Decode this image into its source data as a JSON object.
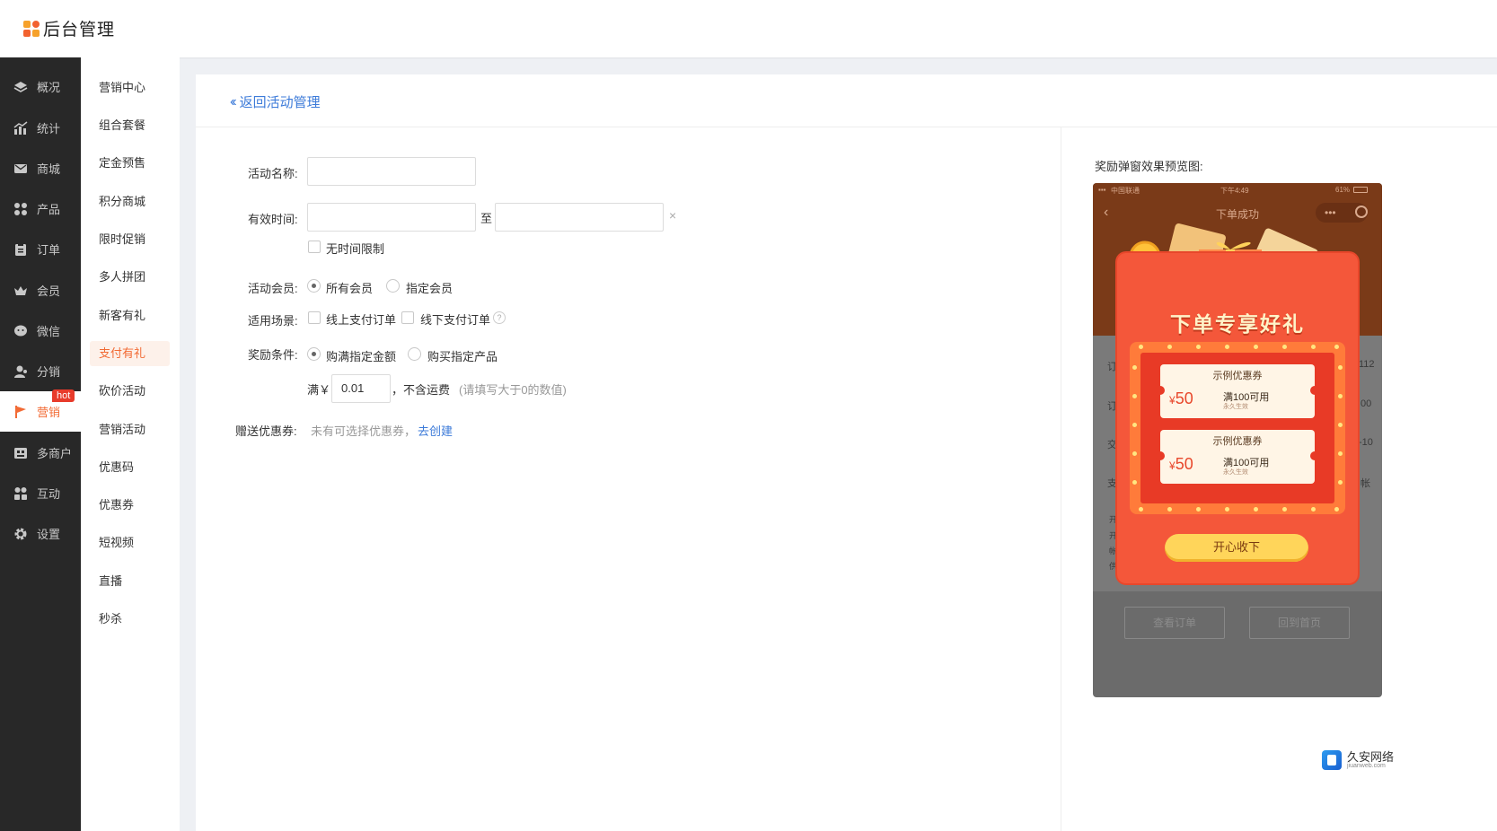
{
  "header": {
    "app_title": "后台管理"
  },
  "primary_nav": {
    "items": [
      {
        "label": "概况",
        "icon": "layers-icon"
      },
      {
        "label": "统计",
        "icon": "chart-icon"
      },
      {
        "label": "商城",
        "icon": "mail-icon"
      },
      {
        "label": "产品",
        "icon": "grid-icon"
      },
      {
        "label": "订单",
        "icon": "clipboard-icon"
      },
      {
        "label": "会员",
        "icon": "crown-icon"
      },
      {
        "label": "微信",
        "icon": "chat-icon"
      },
      {
        "label": "分销",
        "icon": "user-icon"
      },
      {
        "label": "营销",
        "icon": "flag-icon"
      },
      {
        "label": "多商户",
        "icon": "shop-icon"
      },
      {
        "label": "互动",
        "icon": "people-icon"
      },
      {
        "label": "设置",
        "icon": "gear-icon"
      }
    ],
    "hot_badge": "hot"
  },
  "secondary_nav": {
    "items": [
      "营销中心",
      "组合套餐",
      "定金预售",
      "积分商城",
      "限时促销",
      "多人拼团",
      "新客有礼",
      "支付有礼",
      "砍价活动",
      "营销活动",
      "优惠码",
      "优惠券",
      "短视频",
      "直播",
      "秒杀"
    ],
    "active": "支付有礼"
  },
  "page": {
    "back_link": "返回活动管理"
  },
  "form": {
    "name_label": "活动名称:",
    "name_value": "",
    "time_label": "有效时间:",
    "time_start": "",
    "time_sep": "至",
    "time_end": "",
    "time_clear": "×",
    "no_limit_label": "无时间限制",
    "member_label": "活动会员:",
    "member_all": "所有会员",
    "member_specific": "指定会员",
    "scene_label": "适用场景:",
    "scene_online": "线上支付订单",
    "scene_offline": "线下支付订单",
    "help": "?",
    "reward_label": "奖励条件:",
    "reward_amount": "购满指定金额",
    "reward_product": "购买指定产品",
    "full_prefix": "满￥",
    "full_value": "0.01",
    "full_suffix": "，不含运费",
    "full_hint": "(请填写大于0的数值)",
    "coupon_label": "赠送优惠券:",
    "coupon_empty": "未有可选择优惠券，",
    "coupon_create": "去创建"
  },
  "preview": {
    "title": "奖励弹窗效果预览图:",
    "status_carrier": "中国联通",
    "status_time": "下午4:49",
    "status_battery": "61%",
    "nav_title": "下单成功",
    "popup_title": "下单专享好礼",
    "coupons": [
      {
        "name": "示例优惠券",
        "currency": "¥",
        "amount": "50",
        "condition": "满100可用",
        "validity": "永久生效"
      },
      {
        "name": "示例优惠券",
        "currency": "¥",
        "amount": "50",
        "condition": "满100可用",
        "validity": "永久生效"
      }
    ],
    "cta": "开心收下",
    "bottom_buttons": [
      "查看订单",
      "回到首页"
    ],
    "side_fragments_left": [
      "订",
      "订",
      "交",
      "支",
      "开",
      "开",
      "帐",
      "供"
    ],
    "side_fragments_right": [
      "112",
      "00",
      "-10",
      "帐"
    ]
  },
  "watermark": {
    "name": "久安网络",
    "url": "jiuanweb.com"
  },
  "colors": {
    "accent": "#f26b35",
    "link": "#3d7bd9",
    "sidebar_bg": "#282828",
    "popup_red": "#f4573a"
  }
}
